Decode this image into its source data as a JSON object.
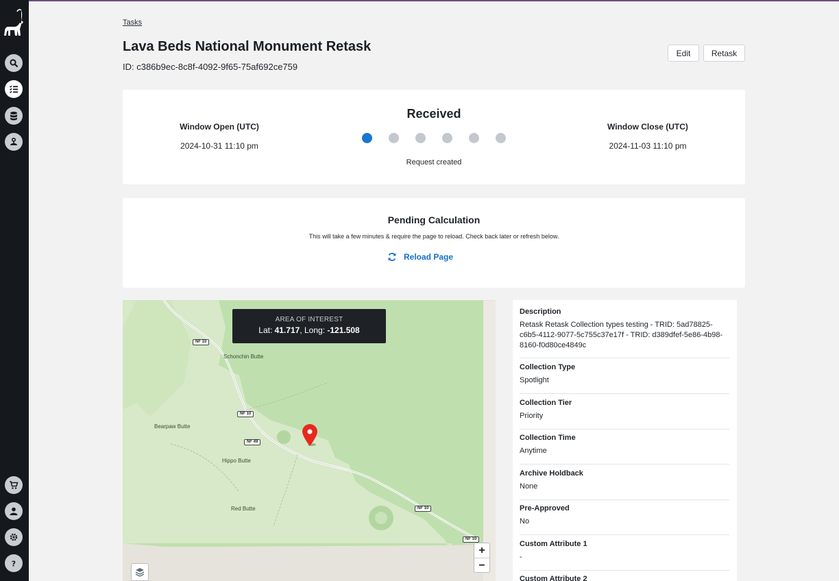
{
  "breadcrumb": "Tasks",
  "task": {
    "title": "Lava Beds National Monument Retask",
    "id_text": "ID: c386b9ec-8c8f-4092-9f65-75af692ce759"
  },
  "actions": {
    "edit": "Edit",
    "retask": "Retask"
  },
  "status": {
    "window_open_label": "Window Open (UTC)",
    "window_open_value": "2024-10-31 11:10 pm",
    "window_close_label": "Window Close (UTC)",
    "window_close_value": "2024-11-03 11:10 pm",
    "title": "Received",
    "subtitle": "Request created",
    "steps_total": 6,
    "steps_completed": 1
  },
  "pending": {
    "title": "Pending Calculation",
    "text": "This will take a few minutes & require the page to reload. Check back later or refresh below.",
    "reload_label": "Reload Page"
  },
  "map": {
    "aoi_label": "AREA OF INTEREST",
    "lat_prefix": "Lat: ",
    "lat": "41.717",
    "long_prefix": ", Long: ",
    "long": "-121.508",
    "places": {
      "schonchin": "Schonchin Butte",
      "bearpaw": "Bearpaw Butte",
      "hippo": "Hippo Butte",
      "redbutte": "Red Butte"
    },
    "roads": {
      "nf10": "NF 10",
      "nf49": "NF 49"
    },
    "zoom_in": "+",
    "zoom_out": "−"
  },
  "details": [
    {
      "label": "Description",
      "value": "Retask Retask Collection types testing - TRID: 5ad78825-c6b5-4112-9077-5c755c37e17f - TRID: d389dfef-5e86-4b98-8160-f0d80ce4849c"
    },
    {
      "label": "Collection Type",
      "value": "Spotlight"
    },
    {
      "label": "Collection Tier",
      "value": "Priority"
    },
    {
      "label": "Collection Time",
      "value": "Anytime"
    },
    {
      "label": "Archive Holdback",
      "value": "None"
    },
    {
      "label": "Pre-Approved",
      "value": "No"
    },
    {
      "label": "Custom Attribute 1",
      "value": "-"
    },
    {
      "label": "Custom Attribute 2",
      "value": ""
    }
  ],
  "colors": {
    "accent": "#1976d2",
    "sidebar": "#15181c",
    "pin": "#e8281c"
  }
}
